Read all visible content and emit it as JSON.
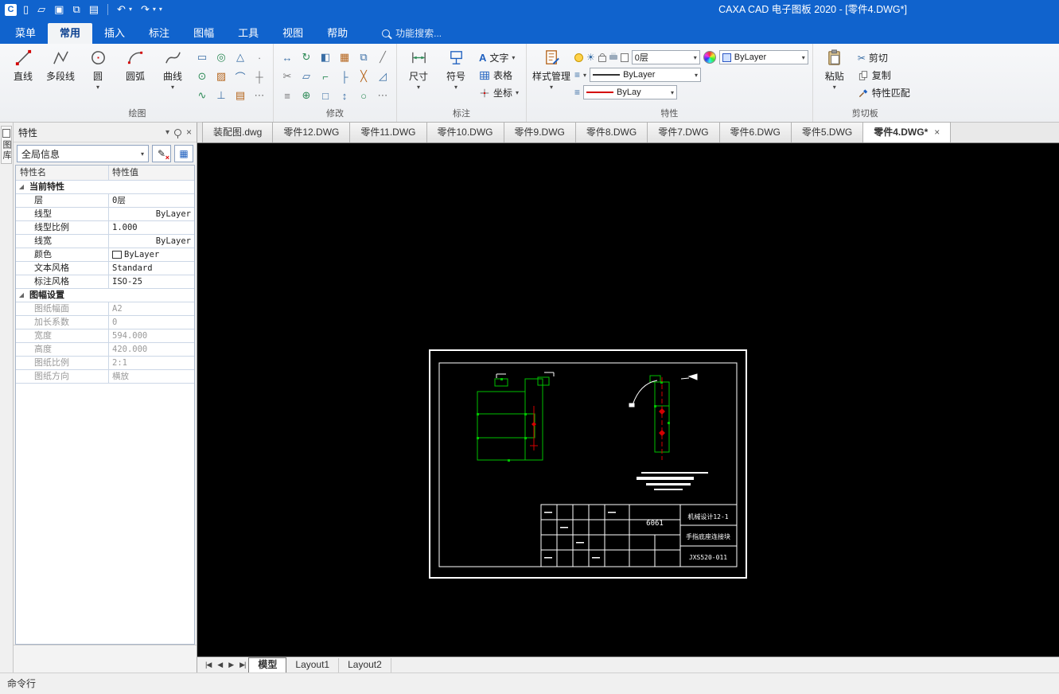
{
  "app": {
    "title": "CAXA CAD 电子图板 2020 - [零件4.DWG*]"
  },
  "icons": {
    "app_logo": "C",
    "new": "▯",
    "open": "▱",
    "save": "▣",
    "save_all": "⧉",
    "print": "▤",
    "undo": "↶",
    "redo": "↷",
    "dropdown": "▾",
    "close": "×",
    "sun": "☀",
    "cut": "✂",
    "text_a": "A",
    "menu_lines": "≡",
    "edit": "✎",
    "grid": "▦",
    "expand": "◢",
    "nav_first": "|◀",
    "nav_prev": "◀",
    "nav_next": "▶",
    "nav_last": "▶|",
    "draw_grid": [
      "▭",
      "◎",
      "△",
      "∙",
      "⊙",
      "▨",
      "⌒",
      "┼",
      "∿",
      "⊥",
      "▤",
      "⋯"
    ],
    "modify_grid": [
      "↔",
      "↻",
      "◧",
      "▦",
      "⧉",
      "╱",
      "✂",
      "▱",
      "⌐",
      "├",
      "╳",
      "◿",
      "≡",
      "⊕",
      "□",
      "↕",
      "○",
      "⋯"
    ]
  },
  "menu": {
    "tabs": [
      {
        "label": "菜单"
      },
      {
        "label": "常用"
      },
      {
        "label": "插入"
      },
      {
        "label": "标注"
      },
      {
        "label": "图幅"
      },
      {
        "label": "工具"
      },
      {
        "label": "视图"
      },
      {
        "label": "帮助"
      }
    ],
    "search": "功能搜索..."
  },
  "ribbon": {
    "draw": {
      "label": "绘图",
      "line": "直线",
      "polyline": "多段线",
      "circle": "圆",
      "arc": "圆弧",
      "spline": "曲线"
    },
    "modify": {
      "label": "修改"
    },
    "annotate": {
      "label": "标注",
      "dimension": "尺寸",
      "symbol": "符号",
      "text": "文字",
      "table": "表格",
      "coordinate": "坐标"
    },
    "props": {
      "label": "特性",
      "style_manager": "样式管理",
      "layer": "0层",
      "color": "ByLayer",
      "linetype": "ByLayer",
      "lineweight": "ByLay"
    },
    "clipboard": {
      "label": "剪切板",
      "paste": "粘贴",
      "cut": "剪切",
      "copy": "复制",
      "match": "特性匹配"
    }
  },
  "panel": {
    "side_tab": "图库",
    "title": "特性",
    "selector": "全局信息",
    "col_name": "特性名",
    "col_value": "特性值",
    "rows": [
      {
        "t": "group",
        "name": "当前特性"
      },
      {
        "t": "row",
        "name": "层",
        "value": "0层"
      },
      {
        "t": "row",
        "name": "线型",
        "value": "ByLayer"
      },
      {
        "t": "row",
        "name": "线型比例",
        "value": "1.000"
      },
      {
        "t": "row",
        "name": "线宽",
        "value": "ByLayer"
      },
      {
        "t": "row",
        "name": "颜色",
        "value": "ByLayer"
      },
      {
        "t": "row",
        "name": "文本风格",
        "value": "Standard"
      },
      {
        "t": "row",
        "name": "标注风格",
        "value": "ISO-25"
      },
      {
        "t": "group",
        "name": "图幅设置"
      },
      {
        "t": "row",
        "name": "图纸幅面",
        "value": "A2"
      },
      {
        "t": "row",
        "name": "加长系数",
        "value": "0"
      },
      {
        "t": "row",
        "name": "宽度",
        "value": "594.000"
      },
      {
        "t": "row",
        "name": "高度",
        "value": "420.000"
      },
      {
        "t": "row",
        "name": "图纸比例",
        "value": "2:1"
      },
      {
        "t": "row",
        "name": "图纸方向",
        "value": "横放"
      }
    ]
  },
  "doc_tabs": [
    {
      "label": "装配图.dwg"
    },
    {
      "label": "零件12.DWG"
    },
    {
      "label": "零件11.DWG"
    },
    {
      "label": "零件10.DWG"
    },
    {
      "label": "零件9.DWG"
    },
    {
      "label": "零件8.DWG"
    },
    {
      "label": "零件7.DWG"
    },
    {
      "label": "零件6.DWG"
    },
    {
      "label": "零件5.DWG"
    },
    {
      "label": "零件4.DWG*"
    }
  ],
  "drawing": {
    "material": "6061",
    "class_text": "机械设计12-1",
    "part_name": "手指底座连接块",
    "drawing_no": "JXS520-011"
  },
  "layout_tabs": {
    "model": "模型",
    "layout1": "Layout1",
    "layout2": "Layout2"
  },
  "status": {
    "command": "命令行"
  }
}
